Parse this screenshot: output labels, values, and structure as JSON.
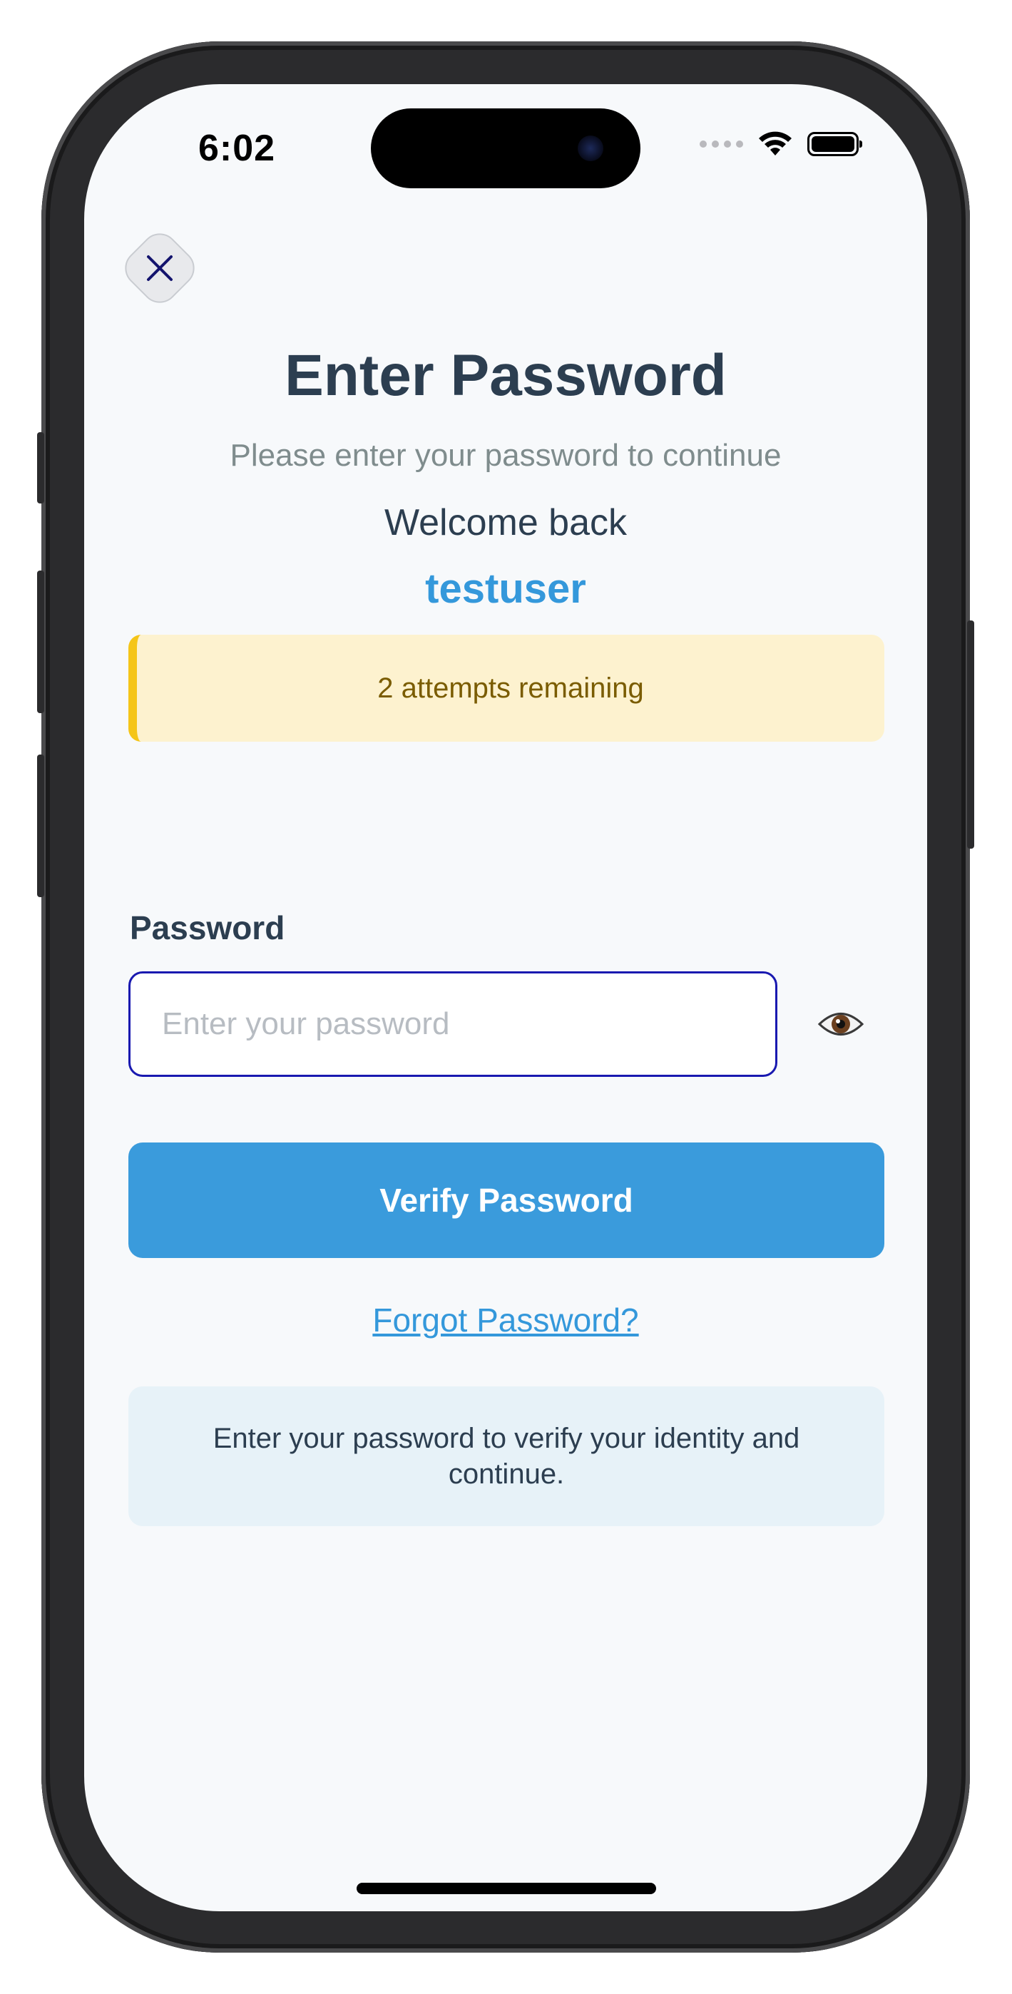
{
  "status_bar": {
    "time": "6:02",
    "icons": [
      "signal-dots-icon",
      "wifi-icon",
      "battery-icon"
    ]
  },
  "header": {
    "close_icon": "close-icon",
    "title": "Enter Password",
    "subtitle": "Please enter your password to continue",
    "welcome": "Welcome back",
    "username": "testuser"
  },
  "warning": {
    "text": "2 attempts remaining",
    "accent_color": "#f5c518",
    "background": "#fdf2cf"
  },
  "form": {
    "password_label": "Password",
    "password_value": "",
    "password_placeholder": "Enter your password",
    "toggle_visibility_icon": "eye-icon",
    "submit_label": "Verify Password",
    "forgot_link": "Forgot Password?"
  },
  "info": {
    "text": "Enter your password to verify your identity and continue."
  },
  "colors": {
    "primary": "#3498db",
    "button": "#3a9bdc",
    "text_dark": "#2c3e50",
    "text_muted": "#7f8c8d",
    "input_border": "#1919b0"
  }
}
